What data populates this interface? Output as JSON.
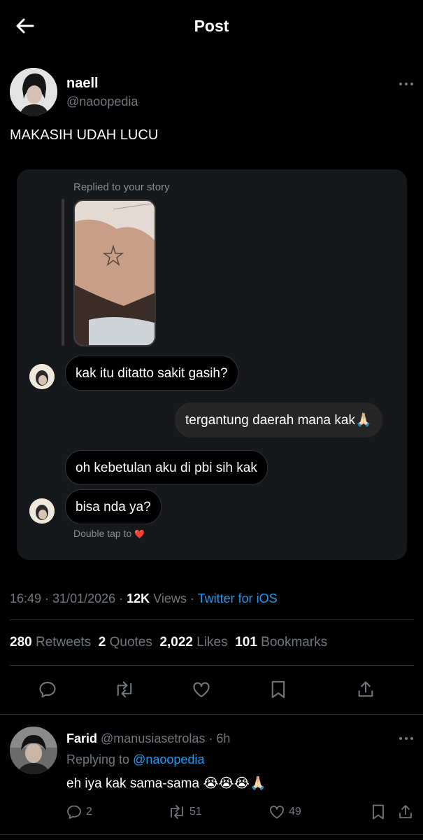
{
  "header": {
    "title": "Post"
  },
  "author": {
    "name": "naell",
    "handle": "@naoopedia"
  },
  "post": {
    "text": "MAKASIH UDAH LUCU"
  },
  "story": {
    "replied_label": "Replied to your story",
    "messages": [
      {
        "text": "kak itu ditatto sakit gasih?",
        "side": "in"
      },
      {
        "text": "tergantung daerah mana kak🙏🏻",
        "side": "out"
      },
      {
        "text": "oh kebetulan aku di pbi sih kak",
        "side": "in"
      },
      {
        "text": "bisa nda ya?",
        "side": "in"
      }
    ],
    "double_tap": "Double tap to",
    "heart": "❤️"
  },
  "meta": {
    "time": "16:49 · 31/01/2026 ·",
    "views_count": "12K",
    "views_label": "Views",
    "sep": "·",
    "source": "Twitter for iOS"
  },
  "stats": {
    "retweets_count": "280",
    "retweets_label": "Retweets",
    "quotes_count": "2",
    "quotes_label": "Quotes",
    "likes_count": "2,022",
    "likes_label": "Likes",
    "bookmarks_count": "101",
    "bookmarks_label": "Bookmarks"
  },
  "reply": {
    "name": "Farid",
    "handle": "@manusiasetrolas",
    "time": "· 6h",
    "replying_label": "Replying to",
    "replying_handle": "@naoopedia",
    "text": "eh iya kak sama-sama 😭😭😭🙏🏻",
    "replies": "2",
    "retweets": "51",
    "likes": "49"
  },
  "icons": [
    "back-arrow-icon",
    "more-icon",
    "reply-icon",
    "retweet-icon",
    "like-icon",
    "bookmark-icon",
    "share-icon"
  ],
  "colors": {
    "background": "#000000",
    "accent": "#1d9bf0",
    "muted": "#71767b",
    "card": "#16181c",
    "divider": "#2f3336"
  }
}
